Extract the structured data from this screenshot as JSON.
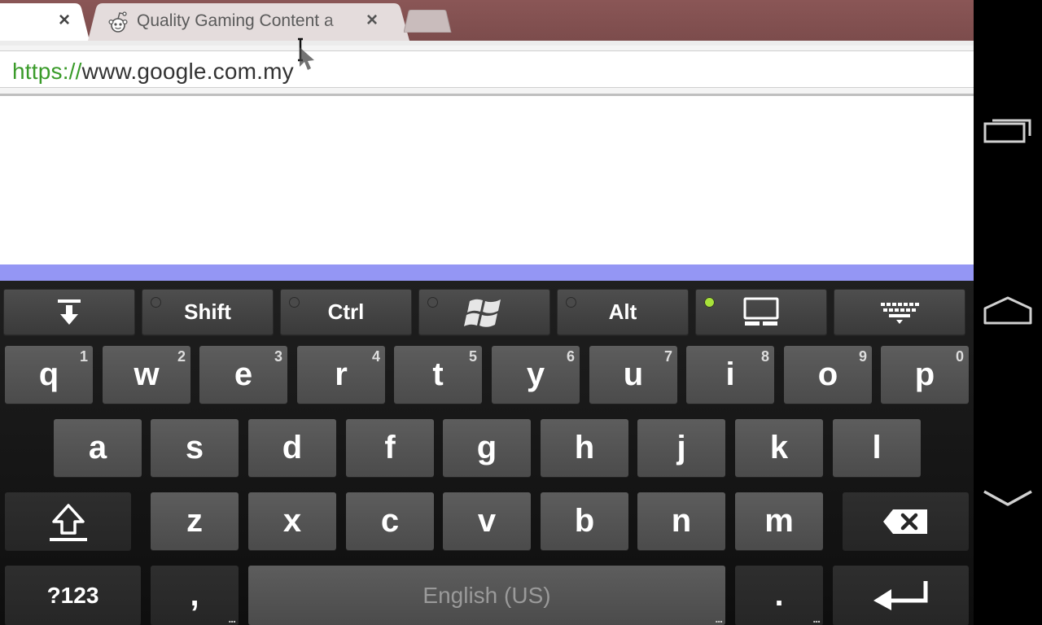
{
  "browser": {
    "tabs": [
      {
        "title": "",
        "close": "×",
        "active": true
      },
      {
        "title": "Quality Gaming Content a",
        "close": "×",
        "active": false
      }
    ],
    "omnibox": {
      "scheme": "https://",
      "host": "www.google.com.my"
    }
  },
  "keyboard": {
    "toolbar": {
      "shift": "Shift",
      "ctrl": "Ctrl",
      "alt": "Alt"
    },
    "rows": {
      "row1": [
        {
          "key": "q",
          "hint": "1"
        },
        {
          "key": "w",
          "hint": "2"
        },
        {
          "key": "e",
          "hint": "3"
        },
        {
          "key": "r",
          "hint": "4"
        },
        {
          "key": "t",
          "hint": "5"
        },
        {
          "key": "y",
          "hint": "6"
        },
        {
          "key": "u",
          "hint": "7"
        },
        {
          "key": "i",
          "hint": "8"
        },
        {
          "key": "o",
          "hint": "9"
        },
        {
          "key": "p",
          "hint": "0"
        }
      ],
      "row2": [
        "a",
        "s",
        "d",
        "f",
        "g",
        "h",
        "j",
        "k",
        "l"
      ],
      "row3": [
        "z",
        "x",
        "c",
        "v",
        "b",
        "n",
        "m"
      ]
    },
    "bottom": {
      "symbols": "?123",
      "comma": ",",
      "space": "English (US)",
      "period": ".",
      "more": "..."
    }
  },
  "colors": {
    "tabstrip": "#7c4c4c",
    "url_scheme": "#3a9b2a",
    "accent_bar": "#9496f4",
    "led_on": "#a8e23a"
  }
}
